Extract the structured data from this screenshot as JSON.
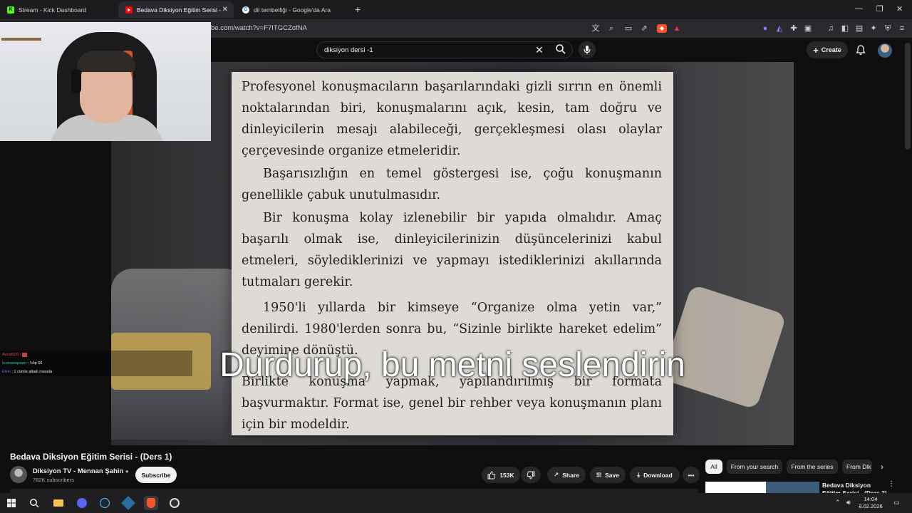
{
  "browser": {
    "tabs": [
      {
        "title": "Stream - Kick Dashboard",
        "active": false
      },
      {
        "title": "Bedava Diksiyon Eğitim Serisi - (",
        "active": true
      },
      {
        "title": "dil tembelliği - Google'da Ara",
        "active": false
      }
    ],
    "url": "be.com/watch?v=F7ITGCZofNA"
  },
  "youtube": {
    "search_query": "diksiyon dersi -1",
    "create_label": "Create",
    "video": {
      "title": "Bedava Diksiyon Eğitim Serisi - (Ders 1)",
      "channel_name": "Diksiyon TV - Mennan Şahin",
      "subscribers": "782K subscribers",
      "subscribe_label": "Subscribe",
      "likes": "153K",
      "share_label": "Share",
      "save_label": "Save",
      "download_label": "Download"
    },
    "page_text": [
      "Profesyonel konuşmacıların başarılarındaki gizli sırrın en önemli noktalarından biri, konuşmalarını açık, kesin, tam doğru ve dinleyicilerin mesajı alabileceği, gerçekleşmesi olası olaylar çerçevesinde organize etmeleridir.",
      "Başarısızlığın en temel göstergesi ise, çoğu konuşmanın genellikle çabuk unutulmasıdır.",
      "Bir konuşma kolay izlenebilir bir yapıda olmalıdır. Amaç başarılı olmak ise, dinleyicilerinizin düşüncelerinizi kabul etmeleri, söylediklerinizi ve yapmayı istediklerinizi akıllarında tutmaları gerekir.",
      "1950'li yıllarda bir kimseye “Organize olma yetin var,” denilirdi. 1980'lerden sonra bu, “Sizinle birlikte hareket edelim” deyimine dönüştü.",
      "Birlikte konuşma yapmak, yapılandırılmış bir formata başvurmaktır. Format ise, genel bir rehber veya konuşmanın planı için bir modeldir."
    ],
    "subtitle": "Durdurup, bu metni seslendirin",
    "chips": [
      "All",
      "From your search",
      "From the series",
      "From Dik"
    ],
    "recommended": {
      "title": "Bedava Diksiyon Eğitim Serisi - (Ders 2)"
    }
  },
  "chat": [
    {
      "user": "Aosat920",
      "text": ""
    },
    {
      "user": "teomanspawn",
      "text": "!clip 60"
    },
    {
      "user": "Elvin",
      "text": "1 cümle atladı mesela"
    }
  ],
  "taskbar": {
    "time": "14:04",
    "date": "8.02.2026"
  },
  "colors": {
    "youtube_bg": "#0f0f0f",
    "kick_green": "#53fc18",
    "youtube_red": "#ff0000",
    "brave_orange": "#fb542b"
  }
}
